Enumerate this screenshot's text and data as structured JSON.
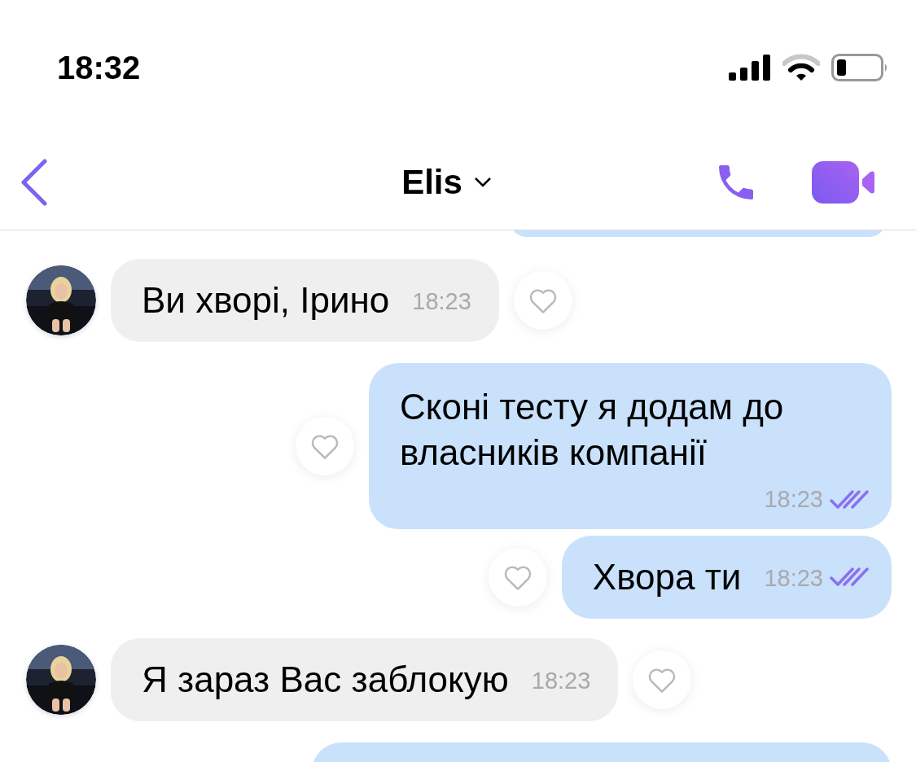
{
  "status_bar": {
    "time": "18:32"
  },
  "header": {
    "title": "Elis"
  },
  "messages": [
    {
      "kind": "incoming",
      "text": "Ви хворі, Ірино",
      "time": "18:23"
    },
    {
      "kind": "outgoing",
      "text": "Сконі тесту я додам до власників компанії",
      "time": "18:23",
      "read": true
    },
    {
      "kind": "outgoing",
      "text": "Хвора ти",
      "time": "18:23",
      "read": true
    },
    {
      "kind": "incoming",
      "text": "Я зараз Вас заблокую",
      "time": "18:23"
    }
  ]
}
